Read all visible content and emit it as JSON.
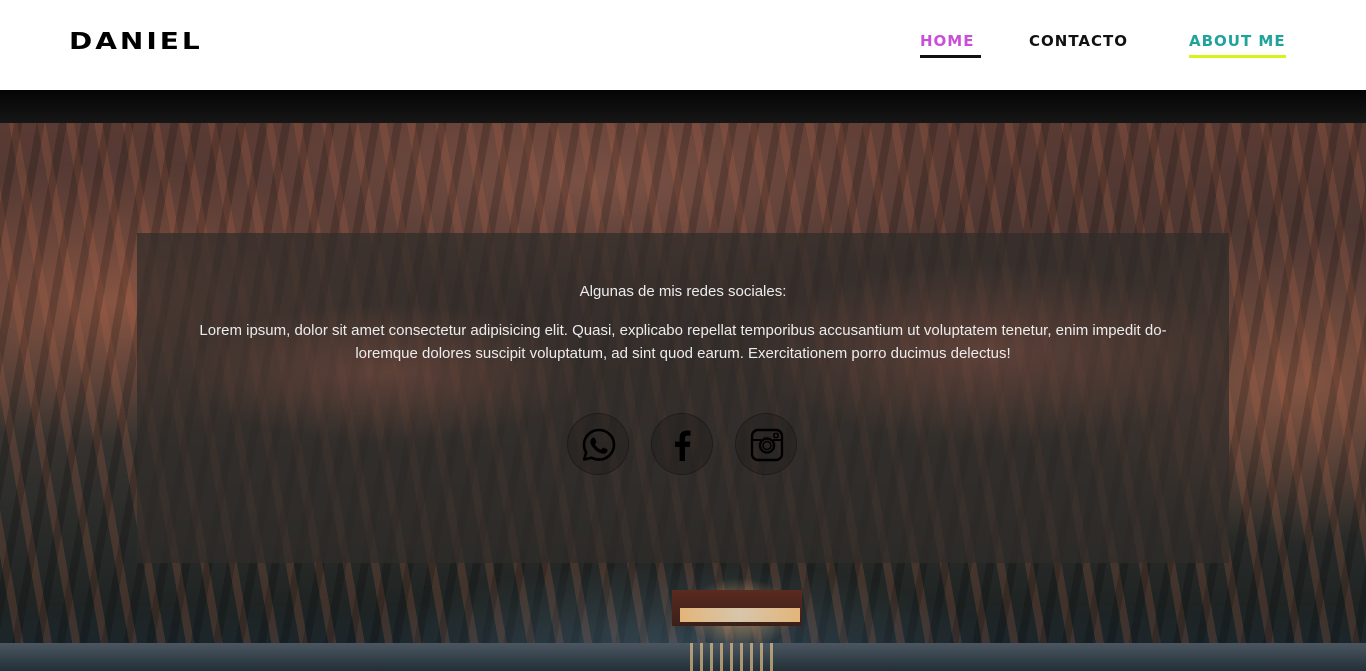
{
  "header": {
    "logo": "DANIEL",
    "nav": [
      {
        "label": "HOME",
        "color": "#c94fd8",
        "underline": "#111111"
      },
      {
        "label": "CONTACTO",
        "color": "#111111"
      },
      {
        "label": "ABOUT ME",
        "color": "#1fa39a",
        "underline": "#d8f21a"
      }
    ]
  },
  "card": {
    "subtitle": "Algunas de mis redes sociales:",
    "paragraph": "Lorem ipsum, dolor sit amet consectetur adipisicing elit. Quasi, explicabo repellat temporibus accusantium ut voluptatem tenetur, enim impedit do-loremque dolores suscipit voluptatum, ad sint quod earum. Exercitationem porro ducimus delectus!",
    "socials": [
      {
        "icon": "whatsapp-icon"
      },
      {
        "icon": "facebook-icon"
      },
      {
        "icon": "instagram-icon"
      }
    ]
  }
}
